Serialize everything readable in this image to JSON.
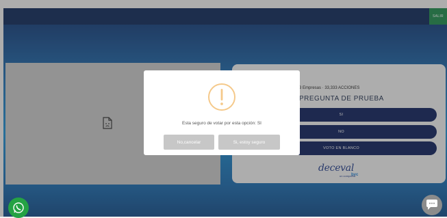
{
  "header": {
    "exit_label": "SALIR"
  },
  "question": {
    "company_line": "3 Empresas · 33,333 ACCIONES",
    "title": "PREGUNTA DE PRUEBA",
    "options": [
      {
        "label": "SI"
      },
      {
        "label": "NO"
      },
      {
        "label": "VOTO EN BLANCO"
      }
    ]
  },
  "brand": {
    "logo_text": "deceval",
    "logo_subtext": "un compañía",
    "logo_tag": "bvc"
  },
  "dialog": {
    "message": "Esta seguro de votar por esta opción: SI",
    "cancel_label": "No,cancelar",
    "confirm_label": "Si, estoy seguro",
    "icon": "warning-exclamation-icon",
    "icon_color": "#f5c98a"
  },
  "floating": {
    "whatsapp_icon": "whatsapp-icon",
    "chat_icon": "chat-support-icon"
  },
  "colors": {
    "accent_navy": "#0c1e5b",
    "topbar": "#0a2657",
    "exit_button": "#1b8a4a"
  }
}
